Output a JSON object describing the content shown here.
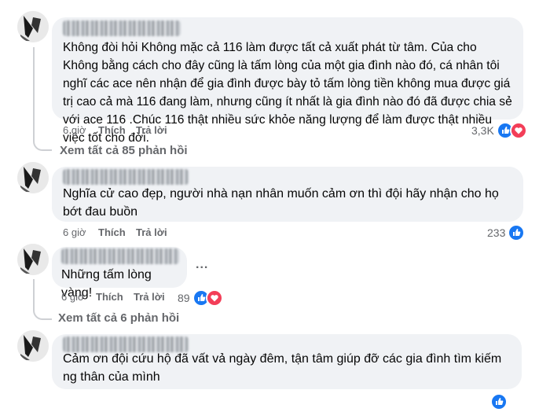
{
  "comments": [
    {
      "text": "Không đòi hỏi Không mặc cả 116 làm được tất cả xuất phát từ tâm. Của cho Không bằng cách cho đây cũng là tấm lòng của một gia đình nào đó, cá nhân tôi nghĩ các ace nên nhận để gia đình được bày tỏ tấm lòng tiền không mua được giá trị cao cả mà 116 đang làm, nhưng cũng ít nhất là gia đình nào đó đã được chia sẻ với ace 116 .Chúc 116 thật nhiều sức khỏe năng lượng để làm được thật nhiều việc tốt cho đời.",
      "time": "6 giờ",
      "like": "Thích",
      "reply": "Trả lời",
      "reactions": "3,3K",
      "view_replies": "Xem tất cả 85 phản hồi"
    },
    {
      "text": "Nghĩa cử cao đẹp, người nhà nạn nhân muốn cảm ơn thì đội hãy nhận cho họ bớt đau buồn",
      "time": "6 giờ",
      "like": "Thích",
      "reply": "Trả lời",
      "reactions": "233"
    },
    {
      "text": "Những tấm lòng vàng!",
      "time": "6 giờ",
      "like": "Thích",
      "reply": "Trả lời",
      "reactions": "89",
      "more": "...",
      "view_replies": "Xem tất cả 6 phản hồi"
    },
    {
      "text": "Cảm ơn đội cứu hộ đã vất vả ngày đêm, tận tâm giúp đỡ các gia đình tìm kiếm ng thân của mình"
    }
  ],
  "colors": {
    "like": "#1877f2",
    "love": "#f33e58",
    "bubble": "#f0f2f5",
    "meta": "#65676b"
  },
  "icons": [
    "like-reaction-icon",
    "love-reaction-icon"
  ]
}
